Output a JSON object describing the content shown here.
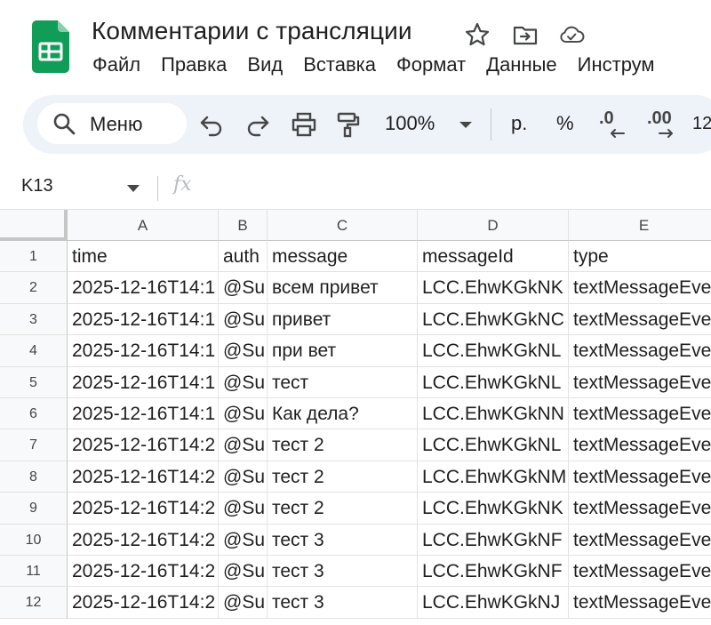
{
  "app": {
    "title": "Комментарии с трансляции",
    "menu": [
      "Файл",
      "Правка",
      "Вид",
      "Вставка",
      "Формат",
      "Данные",
      "Инструм"
    ]
  },
  "toolbar": {
    "search_label": "Меню",
    "zoom": "100%",
    "currency": "р.",
    "percent": "%",
    "dec_decrease": ".0",
    "dec_increase": ".00",
    "font_size_partial": "12"
  },
  "formula_bar": {
    "name_box": "K13",
    "fx": "fx",
    "value": ""
  },
  "grid": {
    "columns": [
      "A",
      "B",
      "C",
      "D",
      "E"
    ],
    "rows": [
      {
        "num": "1",
        "cells": [
          "time",
          "auth",
          "message",
          "messageId",
          "type"
        ]
      },
      {
        "num": "2",
        "cells": [
          "2025-12-16T14:1",
          "@Su",
          "всем привет",
          "LCC.EhwKGkNK",
          "textMessageEve"
        ]
      },
      {
        "num": "3",
        "cells": [
          "2025-12-16T14:1",
          "@Su",
          "привет",
          "LCC.EhwKGkNC",
          "textMessageEve"
        ]
      },
      {
        "num": "4",
        "cells": [
          "2025-12-16T14:1",
          "@Su",
          "при вет",
          "LCC.EhwKGkNL",
          "textMessageEve"
        ]
      },
      {
        "num": "5",
        "cells": [
          "2025-12-16T14:1",
          "@Su",
          "тест",
          "LCC.EhwKGkNL",
          "textMessageEve"
        ]
      },
      {
        "num": "6",
        "cells": [
          "2025-12-16T14:1",
          "@Su",
          "Как дела?",
          "LCC.EhwKGkNN",
          "textMessageEve"
        ]
      },
      {
        "num": "7",
        "cells": [
          "2025-12-16T14:2",
          "@Su",
          "тест 2",
          "LCC.EhwKGkNL",
          "textMessageEve"
        ]
      },
      {
        "num": "8",
        "cells": [
          "2025-12-16T14:2",
          "@Su",
          "тест 2",
          "LCC.EhwKGkNM",
          "textMessageEve"
        ]
      },
      {
        "num": "9",
        "cells": [
          "2025-12-16T14:2",
          "@Su",
          "тест 2",
          "LCC.EhwKGkNK",
          "textMessageEve"
        ]
      },
      {
        "num": "10",
        "cells": [
          "2025-12-16T14:2",
          "@Su",
          "тест 3",
          "LCC.EhwKGkNF",
          "textMessageEve"
        ]
      },
      {
        "num": "11",
        "cells": [
          "2025-12-16T14:2",
          "@Su",
          "тест 3",
          "LCC.EhwKGkNF",
          "textMessageEve"
        ]
      },
      {
        "num": "12",
        "cells": [
          "2025-12-16T14:2",
          "@Su",
          "тест 3",
          "LCC.EhwKGkNJ",
          "textMessageEve"
        ]
      }
    ]
  },
  "colors": {
    "logo_green": "#0f9d58",
    "toolbar_bg": "#eef2f9",
    "header_bg": "#f8f9fa",
    "gridline": "#e1e3e1"
  },
  "icons": [
    "sheets-logo-icon",
    "star-icon",
    "move-to-folder-icon",
    "cloud-saved-icon",
    "search-icon",
    "undo-icon",
    "redo-icon",
    "print-icon",
    "paint-format-icon",
    "dropdown-icon",
    "decrease-decimal-icon",
    "increase-decimal-icon",
    "fx-icon"
  ]
}
